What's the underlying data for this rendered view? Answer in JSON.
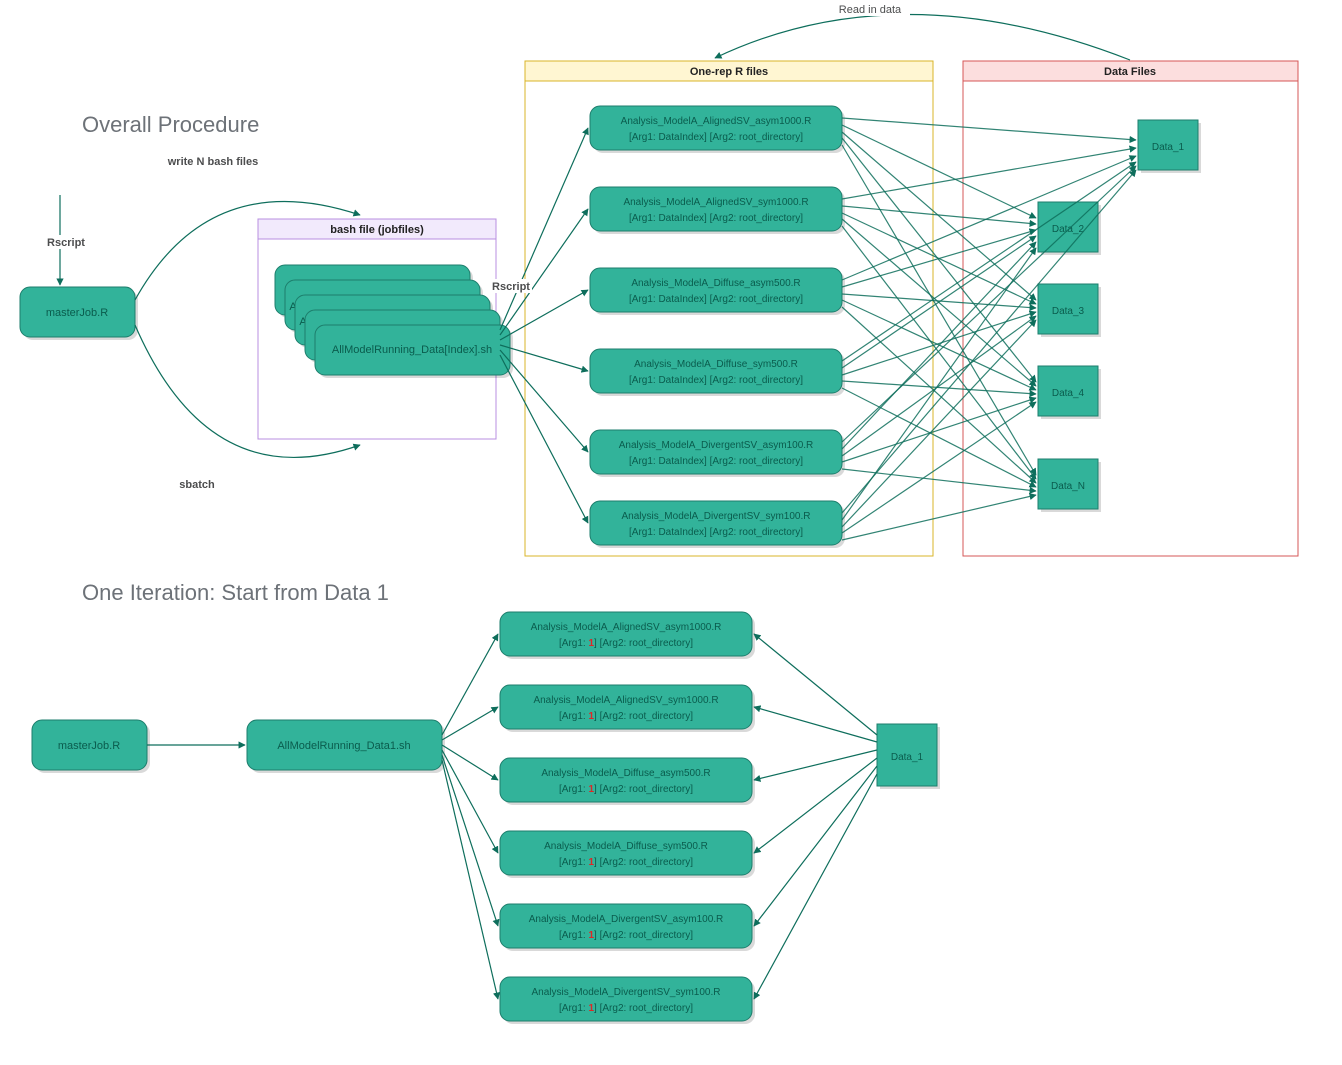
{
  "titles": {
    "section1": "Overall Procedure",
    "section2": "One Iteration: Start from Data 1"
  },
  "containers": {
    "bash": {
      "title": "bash file (jobfiles)"
    },
    "onerep": {
      "title": "One-rep R files"
    },
    "datafiles": {
      "title": "Data Files"
    }
  },
  "edgeLabels": {
    "rscript": "Rscript",
    "writeN": "write N bash files",
    "sbatch": "sbatch",
    "rscript2": "Rscript",
    "readin": "Read in data"
  },
  "top": {
    "master": "masterJob.R",
    "bashNode": "AllModelRunning_Data[Index].sh",
    "bashNodeA": "A",
    "rfiles": [
      {
        "l1": "Analysis_ModelA_AlignedSV_asym1000.R",
        "l2": "[Arg1: DataIndex] [Arg2: root_directory]"
      },
      {
        "l1": "Analysis_ModelA_AlignedSV_sym1000.R",
        "l2": "[Arg1: DataIndex] [Arg2: root_directory]"
      },
      {
        "l1": "Analysis_ModelA_Diffuse_asym500.R",
        "l2": "[Arg1: DataIndex] [Arg2: root_directory]"
      },
      {
        "l1": "Analysis_ModelA_Diffuse_sym500.R",
        "l2": "[Arg1: DataIndex] [Arg2: root_directory]"
      },
      {
        "l1": "Analysis_ModelA_DivergentSV_asym100.R",
        "l2": "[Arg1: DataIndex] [Arg2: root_directory]"
      },
      {
        "l1": "Analysis_ModelA_DivergentSV_sym100.R",
        "l2": "[Arg1: DataIndex] [Arg2: root_directory]"
      }
    ],
    "dataNodes": [
      "Data_1",
      "Data_2",
      "Data_3",
      "Data_4",
      "Data_N"
    ]
  },
  "bottom": {
    "master": "masterJob.R",
    "bashNode": "AllModelRunning_Data1.sh",
    "rfiles": [
      {
        "l1": "Analysis_ModelA_AlignedSV_asym1000.R",
        "l2a": "[Arg1: ",
        "l2red": "1",
        "l2b": "] [Arg2: root_directory]"
      },
      {
        "l1": "Analysis_ModelA_AlignedSV_sym1000.R",
        "l2a": "[Arg1: ",
        "l2red": "1",
        "l2b": "] [Arg2: root_directory]"
      },
      {
        "l1": "Analysis_ModelA_Diffuse_asym500.R",
        "l2a": "[Arg1: ",
        "l2red": "1",
        "l2b": "] [Arg2: root_directory]"
      },
      {
        "l1": "Analysis_ModelA_Diffuse_sym500.R",
        "l2a": "[Arg1: ",
        "l2red": "1",
        "l2b": "] [Arg2: root_directory]"
      },
      {
        "l1": "Analysis_ModelA_DivergentSV_asym100.R",
        "l2a": "[Arg1: ",
        "l2red": "1",
        "l2b": "] [Arg2: root_directory]"
      },
      {
        "l1": "Analysis_ModelA_DivergentSV_sym100.R",
        "l2a": "[Arg1: ",
        "l2red": "1",
        "l2b": "] [Arg2: root_directory]"
      }
    ],
    "dataNode": "Data_1"
  }
}
